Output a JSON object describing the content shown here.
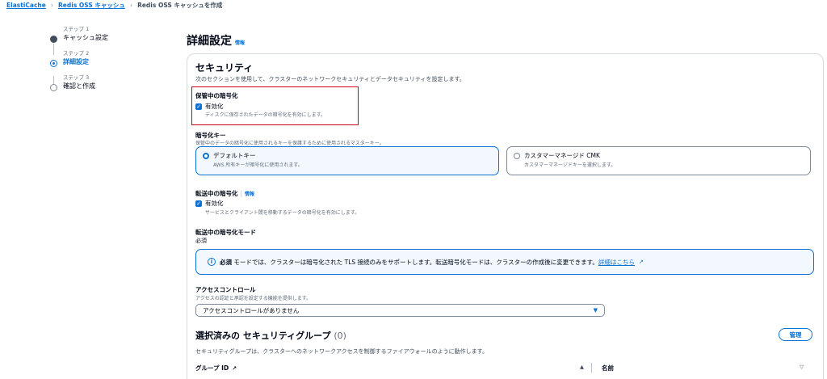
{
  "breadcrumb": {
    "items": [
      "ElastiCache",
      "Redis OSS キャッシュ",
      "Redis OSS キャッシュを作成"
    ]
  },
  "steps": [
    {
      "num": "ステップ 1",
      "name": "キャッシュ設定",
      "state": "done"
    },
    {
      "num": "ステップ 2",
      "name": "詳細設定",
      "state": "current"
    },
    {
      "num": "ステップ 3",
      "name": "確認と作成",
      "state": "todo"
    }
  ],
  "page": {
    "title": "詳細設定",
    "info_label": "情報"
  },
  "security": {
    "title": "セキュリティ",
    "description": "次のセクションを使用して、クラスターのネットワークセキュリティとデータセキュリティを設定します。",
    "at_rest": {
      "label": "保管中の暗号化",
      "checkbox_label": "有効化",
      "checkbox_checked": true,
      "checkbox_desc": "ディスクに保存されたデータの暗号化を有効にします。"
    },
    "key": {
      "label": "暗号化キー",
      "description": "保管中のデータの暗号化に使用されるキーを保護するために使用されるマスターキー。",
      "options": [
        {
          "title": "デフォルトキー",
          "desc": "AWS 所有キーが暗号化に使用されます。",
          "selected": true
        },
        {
          "title": "カスタマーマネージド CMK",
          "desc": "カスタマーマネージドキーを選択します。",
          "selected": false
        }
      ]
    },
    "in_transit": {
      "label": "転送中の暗号化",
      "info_label": "情報",
      "checkbox_label": "有効化",
      "checkbox_checked": true,
      "checkbox_desc": "サービスとクライアント間を移動するデータの暗号化を有効にします。"
    },
    "mode": {
      "label": "転送中の暗号化モード",
      "value": "必須"
    },
    "alert": {
      "bold": "必須",
      "text": " モードでは、クラスターは暗号化された TLS 接続のみをサポートします。転送暗号化モードは、クラスターの作成後に変更できます。",
      "link": "詳細はこちら"
    },
    "access_control": {
      "label": "アクセスコントロール",
      "description": "アクセスの認証と承認を設定する機能を提供します。",
      "selected": "アクセスコントロールがありません"
    },
    "security_groups": {
      "title": "選択済みの セキュリティグループ",
      "count": "(0)",
      "manage_label": "管理",
      "description": "セキュリティグループは、クラスターへのネットワークアクセスを制御するファイアウォールのように動作します。",
      "columns": [
        "グループ ID",
        "名前"
      ]
    }
  },
  "colors": {
    "accent": "#0972d3",
    "highlight_border": "#d0021b"
  }
}
